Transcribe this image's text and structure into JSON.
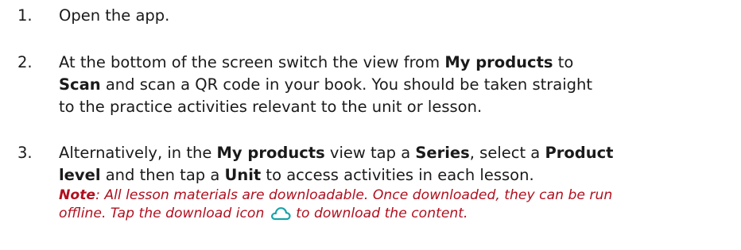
{
  "steps": [
    {
      "number": "1.",
      "text": "Open the app."
    },
    {
      "number": "2.",
      "line1_prefix": "At the bottom of the screen switch the view from ",
      "line1_bold": "My products",
      "line1_suffix": " to",
      "line2_bold": "Scan",
      "line2_suffix": " and scan a QR code in your book. You should be taken straight",
      "line3": "to the practice activities relevant to the unit or lesson."
    },
    {
      "number": "3.",
      "line1_prefix": "Alternatively, in the ",
      "line1_bold1": "My products",
      "line1_mid1": " view tap a ",
      "line1_bold2": "Series",
      "line1_mid2": ", select a ",
      "line1_bold3": "Product",
      "line2_bold1": "level",
      "line2_mid": " and then tap a ",
      "line2_bold2": "Unit",
      "line2_suffix": " to access activities in each lesson.",
      "note_label": "Note",
      "note_line1": ": All lesson materials are downloadable. Once downloaded, they can be run",
      "note_line2_prefix": "offline. Tap the download icon ",
      "note_line2_suffix": " to download the content.",
      "note_icon": "cloud-download-icon"
    }
  ],
  "colors": {
    "text": "#1a1a1a",
    "note": "#b0101f",
    "icon": "#1aa3a8"
  }
}
